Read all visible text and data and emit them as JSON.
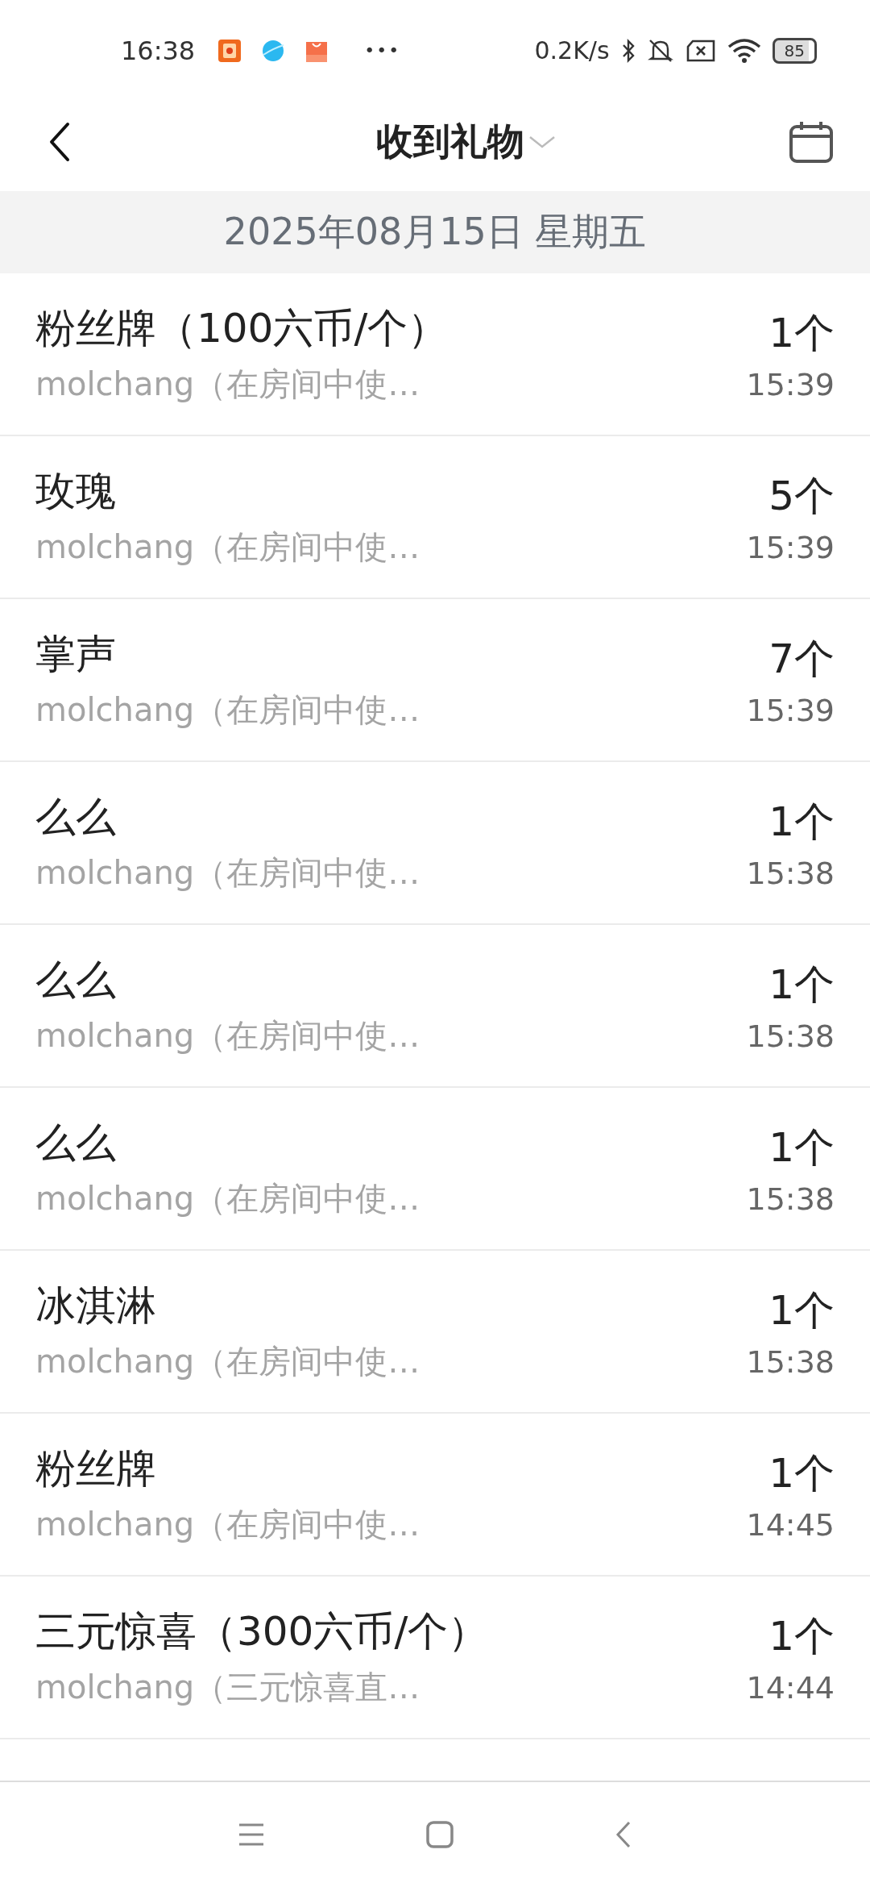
{
  "status_bar": {
    "time": "16:38",
    "speed": "0.2K/s",
    "battery": "85",
    "more": "•••"
  },
  "header": {
    "title": "收到礼物"
  },
  "date": "2025年08月15日 星期五",
  "gifts": [
    {
      "name": "粉丝牌（100六币/个）",
      "sender": "molchang（在房间中使…",
      "count": "1个",
      "time": "15:39"
    },
    {
      "name": "玫瑰",
      "sender": "molchang（在房间中使…",
      "count": "5个",
      "time": "15:39"
    },
    {
      "name": "掌声",
      "sender": "molchang（在房间中使…",
      "count": "7个",
      "time": "15:39"
    },
    {
      "name": "么么",
      "sender": "molchang（在房间中使…",
      "count": "1个",
      "time": "15:38"
    },
    {
      "name": "么么",
      "sender": "molchang（在房间中使…",
      "count": "1个",
      "time": "15:38"
    },
    {
      "name": "么么",
      "sender": "molchang（在房间中使…",
      "count": "1个",
      "time": "15:38"
    },
    {
      "name": "冰淇淋",
      "sender": "molchang（在房间中使…",
      "count": "1个",
      "time": "15:38"
    },
    {
      "name": "粉丝牌",
      "sender": "molchang（在房间中使…",
      "count": "1个",
      "time": "14:45"
    },
    {
      "name": "三元惊喜（300六币/个）",
      "sender": "molchang（三元惊喜直…",
      "count": "1个",
      "time": "14:44"
    }
  ]
}
